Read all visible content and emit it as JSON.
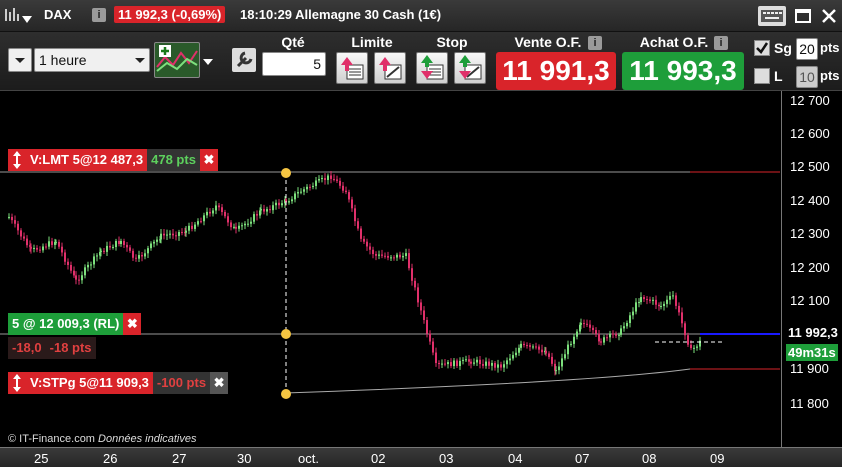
{
  "title": {
    "symbol": "DAX",
    "info": "i",
    "change": "11 992,3 (-0,69%)",
    "time_instrument": "18:10:29 Allemagne 30 Cash (1€)"
  },
  "toolbar": {
    "timeframe": "1 heure",
    "qty_label": "Qté",
    "qty_value": "5",
    "limit_label": "Limite",
    "stop_label": "Stop",
    "sell_label": "Vente O.F.",
    "buy_label": "Achat O.F.",
    "info": "i",
    "sell_price": "11 991,3",
    "buy_price": "11 993,3",
    "sg_label": "Sg",
    "sg_value": "20",
    "l_label": "L",
    "l_value": "10",
    "pts1": "pts",
    "pts2": "pts"
  },
  "orders": {
    "limit": {
      "text": "V:LMT 5@12 487,3",
      "pts": "478 pts"
    },
    "position": {
      "text": "5 @ 12 009,3 (RL)",
      "pl1": "-18,0",
      "pl2": "-18 pts"
    },
    "stop": {
      "text": "V:STPg 5@11 909,3",
      "pts": "-100 pts"
    }
  },
  "yaxis": {
    "labels": [
      "12 700",
      "12 600",
      "12 500",
      "12 400",
      "12 300",
      "12 200",
      "12 100",
      "11 900",
      "11 800"
    ],
    "current": "11 992,3",
    "countdown": "49m31s"
  },
  "xaxis": {
    "labels": [
      "25",
      "26",
      "27",
      "30",
      "oct.",
      "02",
      "03",
      "04",
      "07",
      "08",
      "09"
    ]
  },
  "footer": {
    "brand": "IT-Finance.com",
    "note": "Données indicatives"
  },
  "colors": {
    "up": "#7de07d",
    "down": "#e0306a",
    "sell": "#d9242a",
    "buy": "#1e9e3a"
  }
}
